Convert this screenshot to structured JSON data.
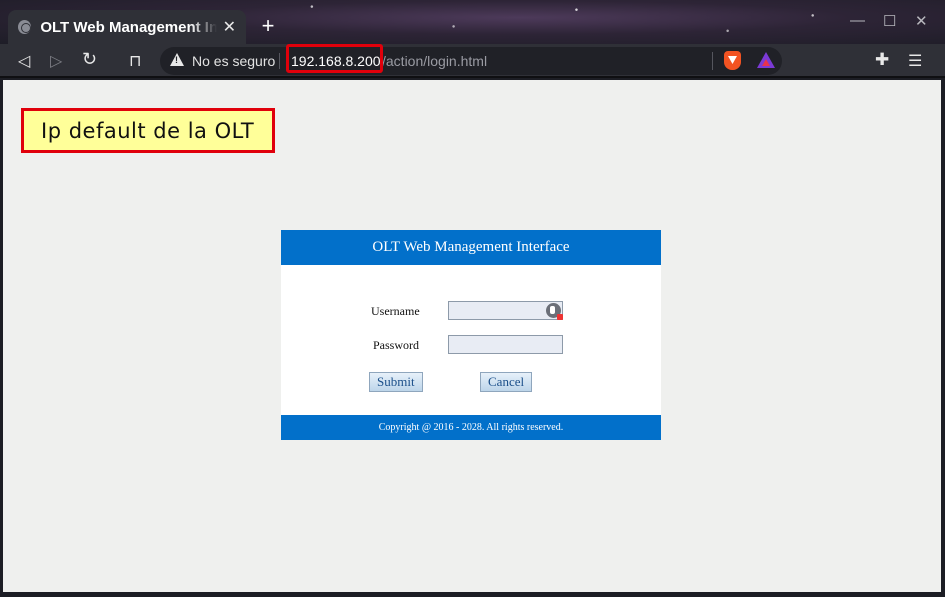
{
  "browser": {
    "tab_title": "OLT Web Management Interface",
    "tab_close": "✕",
    "new_tab": "+",
    "window_controls": {
      "minimize": "—",
      "maximize": "☐",
      "close": "✕"
    },
    "nav": {
      "back": "◁",
      "forward": "▷",
      "reload": "↻",
      "bookmark": "⊓"
    },
    "security_label": "No es seguro",
    "url_host": "192.168.8.200",
    "url_path": "/action/login.html",
    "extensions_icon": "✚",
    "menu_icon": "☰"
  },
  "annotation": {
    "text": "Ip default de la OLT"
  },
  "login": {
    "header": "OLT Web Management Interface",
    "username_label": "Username",
    "password_label": "Password",
    "username_value": "",
    "password_value": "",
    "submit_label": "Submit",
    "cancel_label": "Cancel",
    "footer": "Copyright @ 2016 - 2028. All rights reserved."
  },
  "colors": {
    "accent": "#0270ca",
    "highlight_border": "#e0000b",
    "annotation_bg": "#ffff99"
  }
}
